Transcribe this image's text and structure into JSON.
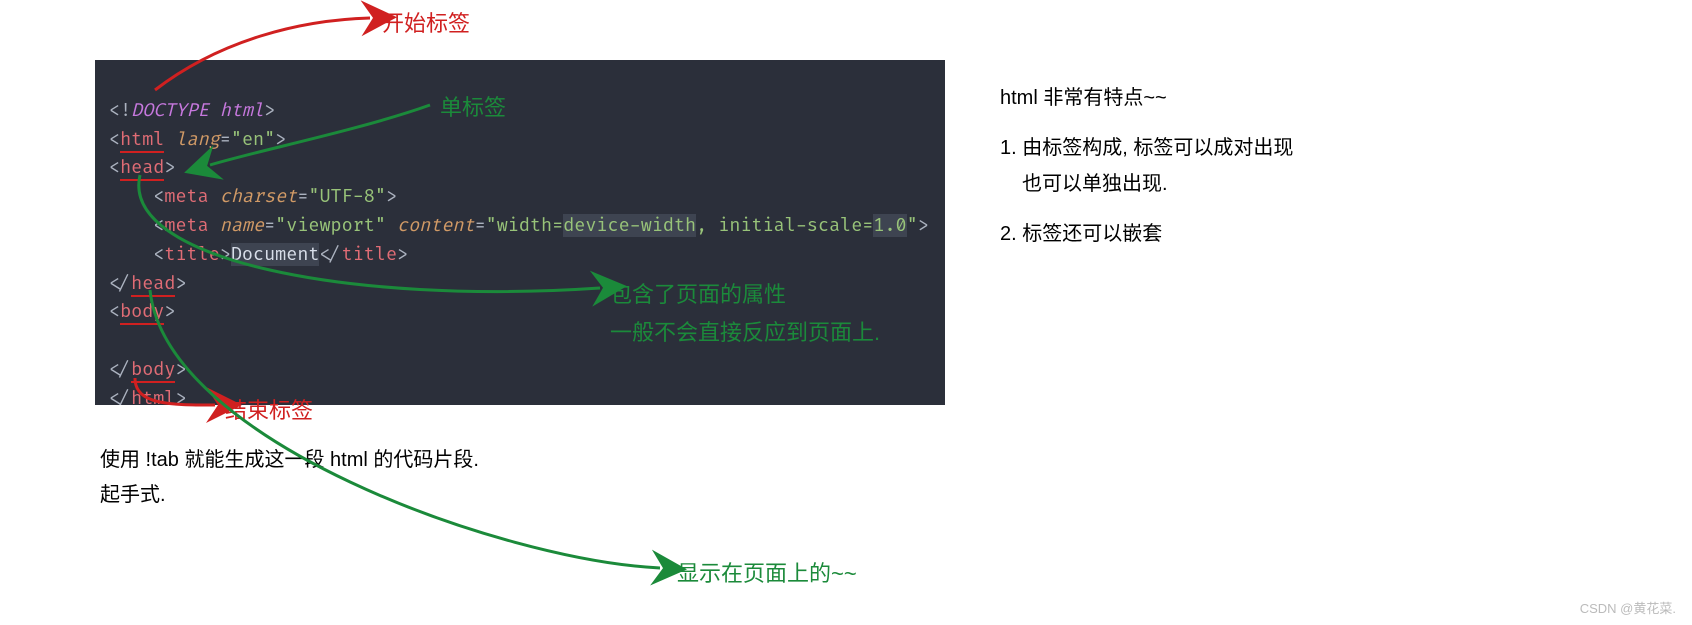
{
  "annotations": {
    "start_tag": "开始标签",
    "single_tag": "单标签",
    "attr_line1": "包含了页面的属性",
    "attr_line2": "一般不会直接反应到页面上.",
    "end_tag": "结束标签",
    "display_on_page": "显示在页面上的~~"
  },
  "code": {
    "l1_doctype": "DOCTYPE html",
    "l2_tag": "html",
    "l2_attr": "lang",
    "l2_val": "en",
    "l3_tag": "head",
    "l4_tag": "meta",
    "l4_attr": "charset",
    "l4_val": "UTF-8",
    "l5_tag": "meta",
    "l5_attr1": "name",
    "l5_val1": "viewport",
    "l5_attr2": "content",
    "l5_val2a": "width=",
    "l5_val2b": "device-width",
    "l5_val2c": ", initial-scale=",
    "l5_val2d": "1.0",
    "l6_tag": "title",
    "l6_text": "Document",
    "l7_tag": "head",
    "l8_tag": "body",
    "l10_tag": "body",
    "l11_tag": "html"
  },
  "caption": {
    "line1": "使用 !tab 就能生成这一段 html 的代码片段.",
    "line2": "起手式."
  },
  "notes": {
    "heading": "html 非常有特点~~",
    "item1a": "1. 由标签构成, 标签可以成对出现",
    "item1b": "也可以单独出现.",
    "item2": "2. 标签还可以嵌套"
  },
  "watermark": "CSDN @黄花菜."
}
